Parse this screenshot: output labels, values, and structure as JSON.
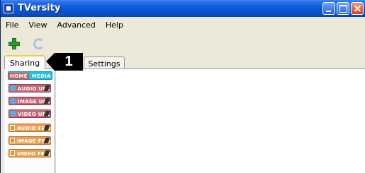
{
  "window": {
    "title": "TVersity"
  },
  "menu": {
    "items": [
      "File",
      "View",
      "Advanced",
      "Help"
    ]
  },
  "tabs": {
    "sharing": "Sharing",
    "settings": "Settings"
  },
  "callout": {
    "number": "1"
  },
  "sidebar": {
    "home_media": {
      "home": "HOME",
      "media": "MEDIA"
    },
    "items": [
      {
        "label": "AUDIO URL",
        "icon": "globe-icon",
        "type": "url"
      },
      {
        "label": "IMAGE URL",
        "icon": "globe-icon",
        "type": "url"
      },
      {
        "label": "VIDEO URL",
        "icon": "globe-icon",
        "type": "url"
      },
      {
        "label": "AUDIO FEED",
        "icon": "rss-icon",
        "type": "feed"
      },
      {
        "label": "IMAGE FEED",
        "icon": "rss-icon",
        "type": "feed"
      },
      {
        "label": "VIDEO FEED",
        "icon": "rss-icon",
        "type": "feed"
      }
    ]
  },
  "colors": {
    "titlebar": "#0a5ad7",
    "tab_accent": "#ffc83c",
    "home_media": "#1ec1e8",
    "url_item": "#c46a78",
    "feed_item": "#e7a255"
  }
}
